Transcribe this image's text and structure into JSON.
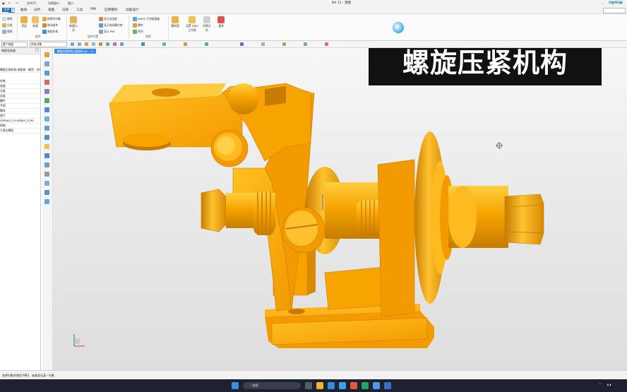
{
  "titlebar": {
    "quick_access": [
      "文件(F)",
      "切换窗口",
      "窗口"
    ],
    "title": "NX 12 - 建模",
    "brand": "SIEMENS"
  },
  "menu": {
    "tabs": [
      "主页",
      "曲线",
      "分析",
      "视图",
      "渲染",
      "工具",
      "PMI",
      "应用模块",
      "动画设计"
    ],
    "active": "主页"
  },
  "ribbon": {
    "buttons_col1": [
      "移除",
      "分组",
      "替换"
    ],
    "big": [
      "添加",
      "新建",
      "新建父项"
    ],
    "assy_col": [
      "按零件对象",
      "移动组件",
      "装配约束"
    ],
    "col3": [
      "显示自由度",
      "显示和隐藏约束",
      "显示 PMI"
    ],
    "groups": [
      "组件",
      "组件位置",
      "常规"
    ],
    "wave": [
      "WAVE 几何链接器",
      "爆炸",
      "序列"
    ],
    "cols4": [
      "爆炸图",
      "设置 DMU 工作表",
      "间隙分析",
      "重装"
    ]
  },
  "toolrow": {
    "filter_label": "整个装配",
    "select_label": "所有对象"
  },
  "navigator": {
    "header": "装配导航器",
    "items": [
      "螺旋压紧机构 装配体（顺序：时间顺序）",
      "约束",
      "底座",
      "压板",
      "支架",
      "螺杆",
      "手柄",
      "螺母",
      "垫片",
      "SPRING_CYLINDER_COM...",
      "销轴",
      "六角头螺栓"
    ]
  },
  "document": {
    "tab_label": "螺旋压紧机构_装配体.prt",
    "close": "×"
  },
  "overlay": {
    "text": "螺旋压紧机构"
  },
  "status": {
    "text": "选择对象并使用 MB3，或者双击某一对象"
  },
  "taskbar": {
    "search": "搜索"
  },
  "colors": {
    "part": "#f7a400",
    "part_dark": "#c67c00",
    "overlay_bg": "#111111",
    "accent": "#1d6fb8"
  }
}
